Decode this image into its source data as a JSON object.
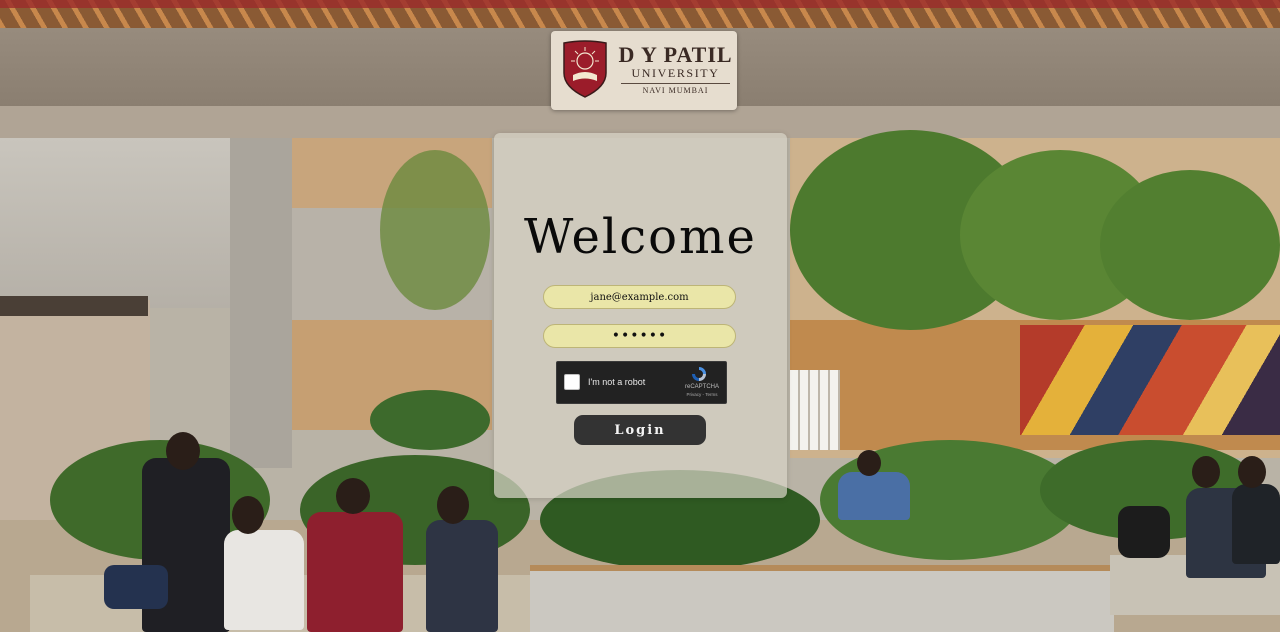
{
  "logo": {
    "name": "D Y PATIL",
    "subtitle": "UNIVERSITY",
    "location": "NAVI MUMBAI"
  },
  "form": {
    "heading": "Welcome",
    "email_value": "jane@example.com",
    "password_value": "••••••",
    "login_label": "Login"
  },
  "captcha": {
    "label": "I'm not a robot",
    "brand": "reCAPTCHA",
    "terms": "Privacy - Terms"
  },
  "colors": {
    "field_bg": "#eae6a8",
    "button_bg": "#333333",
    "card_bg": "rgba(215,210,198,0.72)",
    "logo_crest": "#9b1c2a"
  },
  "icons": [
    "university-crest-icon",
    "recaptcha-icon",
    "checkbox-icon"
  ]
}
